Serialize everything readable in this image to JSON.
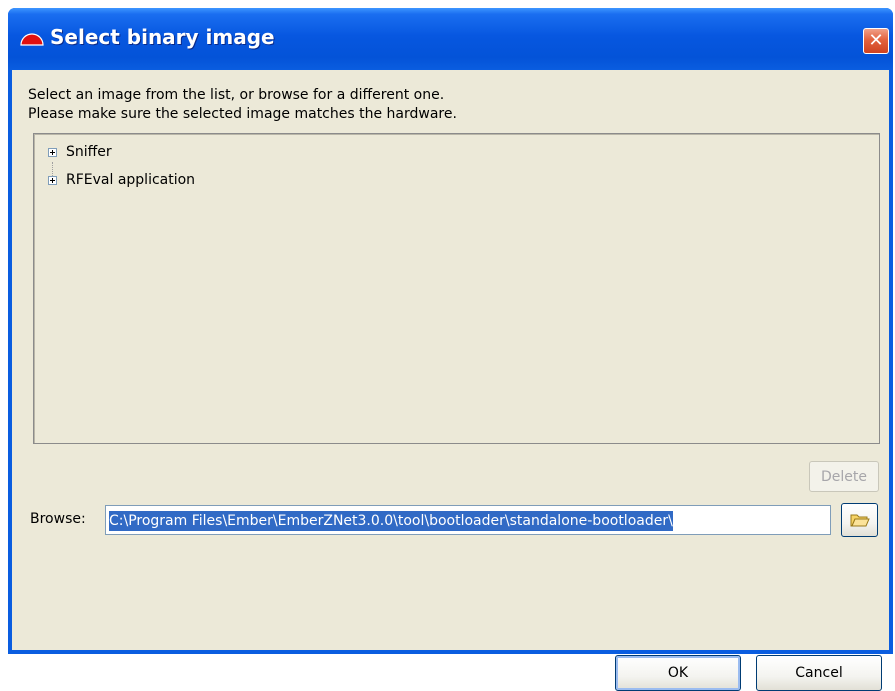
{
  "window": {
    "title": "Select binary image",
    "close_glyph": "✕",
    "icon": "half-circle-app-icon"
  },
  "instructions": {
    "line1": "Select an image from the list, or browse for a different one.",
    "line2": "Please make sure the selected image matches the hardware."
  },
  "tree": {
    "items": [
      {
        "label": "Sniffer",
        "expanded": false
      },
      {
        "label": "RFEval application",
        "expanded": false
      }
    ]
  },
  "buttons": {
    "delete": "Delete",
    "ok": "OK",
    "cancel": "Cancel"
  },
  "browse": {
    "label": "Browse:",
    "value": "C:\\Program Files\\Ember\\EmberZNet3.0.0\\tool\\bootloader\\standalone-bootloader\\",
    "button_icon": "folder-open-icon"
  },
  "colors": {
    "titlebar": "#0453d8",
    "dialog_bg": "#ece9d8",
    "selection": "#316ac5",
    "close_button": "#e3623e"
  }
}
